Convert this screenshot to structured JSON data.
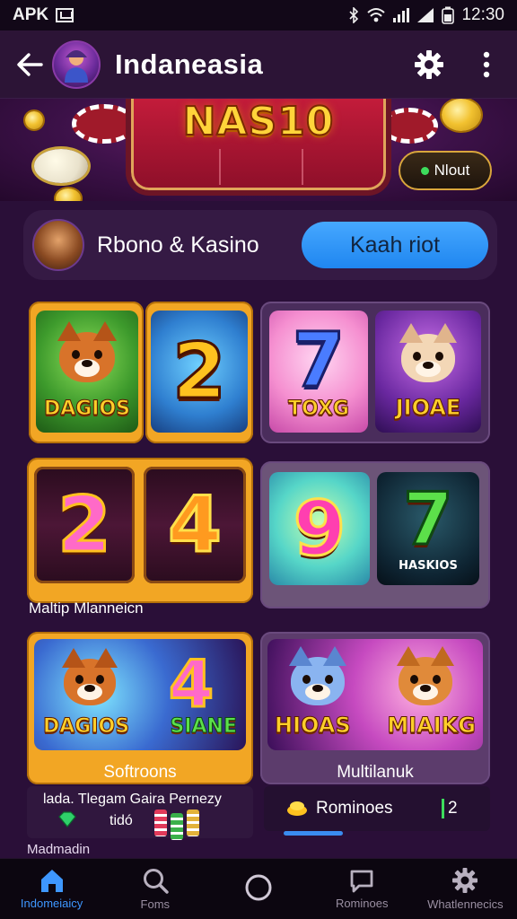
{
  "status_bar": {
    "left_text": "APK",
    "time": "12:30"
  },
  "app_bar": {
    "title": "Indaneasia"
  },
  "banner": {
    "title": "NAS10",
    "button_label": "Nlout"
  },
  "promo": {
    "text": "Rbono & Kasino",
    "button_label": "Kaah riot"
  },
  "games": {
    "group1": {
      "tile1_label": "DAGIOS",
      "tile2_number": "2"
    },
    "group2": {
      "tile1_number": "7",
      "tile1_label": "TOXG",
      "tile2_label": "JIOAE"
    },
    "group3": {
      "tile1_number": "2",
      "tile2_number": "4",
      "section_label": "Maltip Mlanneicn"
    },
    "group4": {
      "tile1_number": "9",
      "tile2_number": "7",
      "tile2_label": "HASKIOS"
    },
    "group5": {
      "tile1_label": "DAGIOS",
      "tile2_number": "4",
      "tile2_label": "SIANE",
      "caption": "Softroons"
    },
    "group6": {
      "tile1_label": "HIOAS",
      "tile2_label": "MIAIKG",
      "caption": "Multilanuk"
    }
  },
  "info_row": {
    "left_line1": "lada. Tlegam Gaira Pernezy",
    "left_line2": "tidó",
    "right_label": "Rominoes",
    "right_count": "2"
  },
  "footer_label": "Madmadin",
  "nav": [
    {
      "label": "Indomeiaicy",
      "icon": "home-icon"
    },
    {
      "label": "Foms",
      "icon": "search-icon"
    },
    {
      "label": "",
      "icon": "circle-icon"
    },
    {
      "label": "Rominoes",
      "icon": "chat-icon"
    },
    {
      "label": "Whatlennecics",
      "icon": "gear-icon"
    }
  ],
  "colors": {
    "background": "#2a0f38",
    "accent_blue": "#3e97ff",
    "gold_frame": "#f2a624",
    "purple_frame": "#4a2d5c"
  }
}
